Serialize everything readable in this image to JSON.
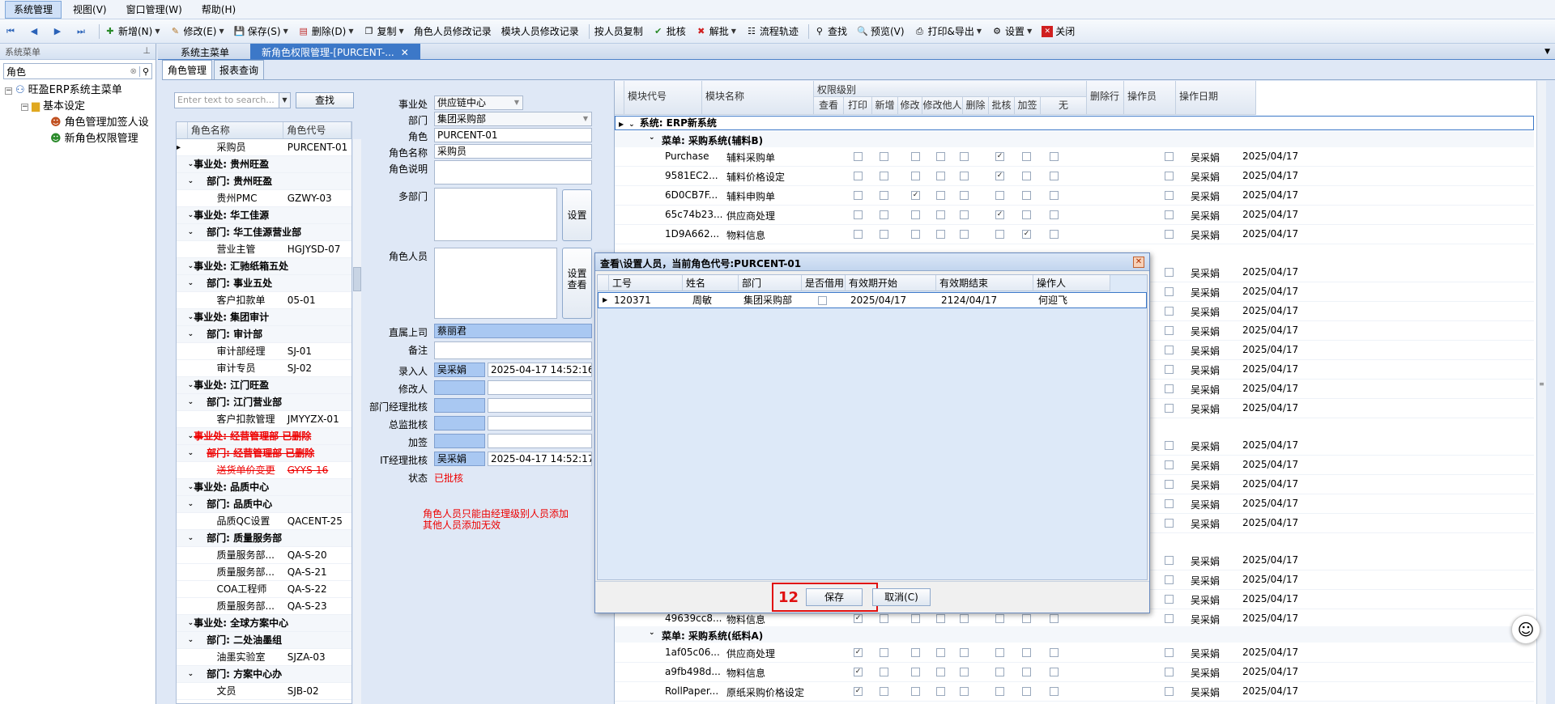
{
  "menubar": {
    "items": [
      "系统管理",
      "视图(V)",
      "窗口管理(W)",
      "帮助(H)"
    ]
  },
  "toolbar": {
    "new": "新增(N)",
    "edit": "修改(E)",
    "save": "保存(S)",
    "delete": "删除(D)",
    "copy": "复制",
    "role_log": "角色人员修改记录",
    "module_log": "模块人员修改记录",
    "copy_by_person": "按人员复制",
    "approve": "批核",
    "unapprove": "解批",
    "flow": "流程轨迹",
    "find": "查找",
    "preview": "预览(V)",
    "print": "打印&导出",
    "settings": "设置",
    "close": "关闭"
  },
  "nav": {
    "header": "系统菜单",
    "search_value": "角色",
    "tree": [
      "旺盈ERP系统主菜单",
      "基本设定",
      "角色管理加签人设",
      "新角色权限管理"
    ]
  },
  "tabs": {
    "main": [
      "系统主菜单",
      "新角色权限管理-[PURCENT-..."
    ]
  },
  "subtabs": [
    "角色管理",
    "报表查询"
  ],
  "rolelist": {
    "search_placeholder": "Enter text to search...",
    "search_button": "查找",
    "columns": [
      "角色名称",
      "角色代号"
    ],
    "rows": [
      {
        "name": "采购员",
        "code": "PURCENT-01"
      },
      {
        "name": "事业处: 贵州旺盈",
        "code": ""
      },
      {
        "name": "部门: 贵州旺盈",
        "code": ""
      },
      {
        "name": "贵州PMC",
        "code": "GZWY-03"
      },
      {
        "name": "事业处: 华工佳源",
        "code": ""
      },
      {
        "name": "部门: 华工佳源营业部",
        "code": ""
      },
      {
        "name": "营业主管",
        "code": "HGJYSD-07"
      },
      {
        "name": "事业处: 汇驰纸箱五处",
        "code": ""
      },
      {
        "name": "部门: 事业五处",
        "code": ""
      },
      {
        "name": "客户扣款单",
        "code": "05-01"
      },
      {
        "name": "事业处: 集团审计",
        "code": ""
      },
      {
        "name": "部门: 审计部",
        "code": ""
      },
      {
        "name": "审计部经理",
        "code": "SJ-01"
      },
      {
        "name": "审计专员",
        "code": "SJ-02"
      },
      {
        "name": "事业处: 江门旺盈",
        "code": ""
      },
      {
        "name": "部门: 江门营业部",
        "code": ""
      },
      {
        "name": "客户扣款管理",
        "code": "JMYYZX-01"
      },
      {
        "name": "事业处: 经营管理部 已删除",
        "code": ""
      },
      {
        "name": "部门: 经营管理部 已删除",
        "code": ""
      },
      {
        "name": "送货单价变更",
        "code": "GYYS-16"
      },
      {
        "name": "事业处: 品质中心",
        "code": ""
      },
      {
        "name": "部门: 品质中心",
        "code": ""
      },
      {
        "name": "品质QC设置",
        "code": "QACENT-25"
      },
      {
        "name": "部门: 质量服务部",
        "code": ""
      },
      {
        "name": "质量服务部...",
        "code": "QA-S-20"
      },
      {
        "name": "质量服务部...",
        "code": "QA-S-21"
      },
      {
        "name": "COA工程师",
        "code": "QA-S-22"
      },
      {
        "name": "质量服务部...",
        "code": "QA-S-23"
      },
      {
        "name": "事业处: 全球方案中心",
        "code": ""
      },
      {
        "name": "部门: 二处油墨组",
        "code": ""
      },
      {
        "name": "油墨实验室",
        "code": "SJZA-03"
      },
      {
        "name": "部门: 方案中心办",
        "code": ""
      },
      {
        "name": "文员",
        "code": "SJB-02"
      }
    ]
  },
  "form": {
    "labels": {
      "division": "事业处",
      "dept": "部门",
      "role": "角色",
      "role_name": "角色名称",
      "role_desc": "角色说明",
      "multi_dept": "多部门",
      "role_people": "角色人员",
      "supervisor": "直属上司",
      "remark": "备注",
      "entered_by": "录入人",
      "modified_by": "修改人",
      "dept_mgr": "部门经理批核",
      "director": "总监批核",
      "countersign": "加签",
      "it_mgr": "IT经理批核",
      "status": "状态"
    },
    "values": {
      "division": "供应链中心",
      "dept": "集团采购部",
      "role": "PURCENT-01",
      "role_name": "采购员",
      "supervisor": "蔡丽君",
      "entered_by": "吴采娟",
      "entered_time": "2025-04-17 14:52:16",
      "it_mgr": "吴采娟",
      "it_time": "2025-04-17 14:52:17",
      "status": "已批核"
    },
    "set_button": "设置",
    "set_view_button": "设置查看",
    "note1": "角色人员只能由经理级别人员添加",
    "note2": "其他人员添加无效"
  },
  "perm": {
    "headers": {
      "code": "模块代号",
      "name": "模块名称",
      "level": "权限级别",
      "delrow": "删除行",
      "operator": "操作员",
      "date": "操作日期"
    },
    "sub": [
      "查看",
      "打印",
      "新增",
      "修改",
      "修改他人",
      "删除",
      "批核",
      "加签",
      "无"
    ],
    "system_row": "系统: ERP新系统",
    "menu_b": "菜单: 采购系统(辅料B)",
    "menu_a": "菜单: 采购系统(纸料A)",
    "rows_top": [
      {
        "code": "Purchase",
        "name": "辅料采购单",
        "checks": [
          0,
          0,
          0,
          0,
          0,
          1,
          0,
          0,
          0
        ],
        "op": "吴采娟",
        "date": "2025/04/17"
      },
      {
        "code": "9581EC2...",
        "name": "辅料价格设定",
        "checks": [
          0,
          0,
          0,
          0,
          0,
          1,
          0,
          0,
          0
        ],
        "op": "吴采娟",
        "date": "2025/04/17"
      },
      {
        "code": "6D0CB7F...",
        "name": "辅料申购单",
        "checks": [
          0,
          0,
          1,
          0,
          0,
          0,
          0,
          0,
          0
        ],
        "op": "吴采娟",
        "date": "2025/04/17"
      },
      {
        "code": "65c74b23...",
        "name": "供应商处理",
        "checks": [
          0,
          0,
          0,
          0,
          0,
          1,
          0,
          0,
          0
        ],
        "op": "吴采娟",
        "date": "2025/04/17"
      },
      {
        "code": "1D9A662...",
        "name": "物料信息",
        "checks": [
          0,
          0,
          0,
          0,
          0,
          0,
          1,
          0,
          0
        ],
        "op": "吴采娟",
        "date": "2025/04/17"
      }
    ],
    "hidden_ops": [
      "吴采娟",
      "吴采娟",
      "吴采娟",
      "吴采娟",
      "吴采娟",
      "吴采娟",
      "吴采娟",
      "吴采娟",
      "吴采娟",
      "吴采娟",
      "吴采娟",
      "吴采娟",
      "吴采娟",
      "吴采娟",
      "吴采娟",
      "吴采娟"
    ],
    "hidden_date": "2025/04/17",
    "row_hidden_tail": {
      "code": "49639cc8...",
      "name": "物料信息",
      "op": "吴采娟",
      "date": "2025/04/17"
    },
    "rows_bottom": [
      {
        "code": "1af05c06...",
        "name": "供应商处理",
        "checks": [
          1,
          0,
          0,
          0,
          0,
          0,
          0,
          0,
          0
        ],
        "op": "吴采娟",
        "date": "2025/04/17"
      },
      {
        "code": "a9fb498d...",
        "name": "物料信息",
        "checks": [
          1,
          0,
          0,
          0,
          0,
          0,
          0,
          0,
          0
        ],
        "op": "吴采娟",
        "date": "2025/04/17"
      },
      {
        "code": "RollPaper...",
        "name": "原纸采购价格设定",
        "checks": [
          1,
          0,
          0,
          0,
          0,
          0,
          0,
          0,
          0
        ],
        "op": "吴采娟",
        "date": "2025/04/17"
      }
    ]
  },
  "dialog": {
    "title": "查看\\设置人员，当前角色代号:PURCENT-01",
    "columns": [
      "工号",
      "姓名",
      "部门",
      "是否借用",
      "有效期开始",
      "有效期结束",
      "操作人"
    ],
    "row": {
      "id": "120371",
      "name": "周敏",
      "dept": "集团采购部",
      "start": "2025/04/17",
      "end": "2124/04/17",
      "operator": "何迎飞"
    },
    "save": "保存",
    "cancel": "取消(C)",
    "annotation": "12"
  },
  "colors": {
    "accent": "#3c78c8",
    "selection": "#a9c8f2",
    "annotation": "#e01010"
  }
}
